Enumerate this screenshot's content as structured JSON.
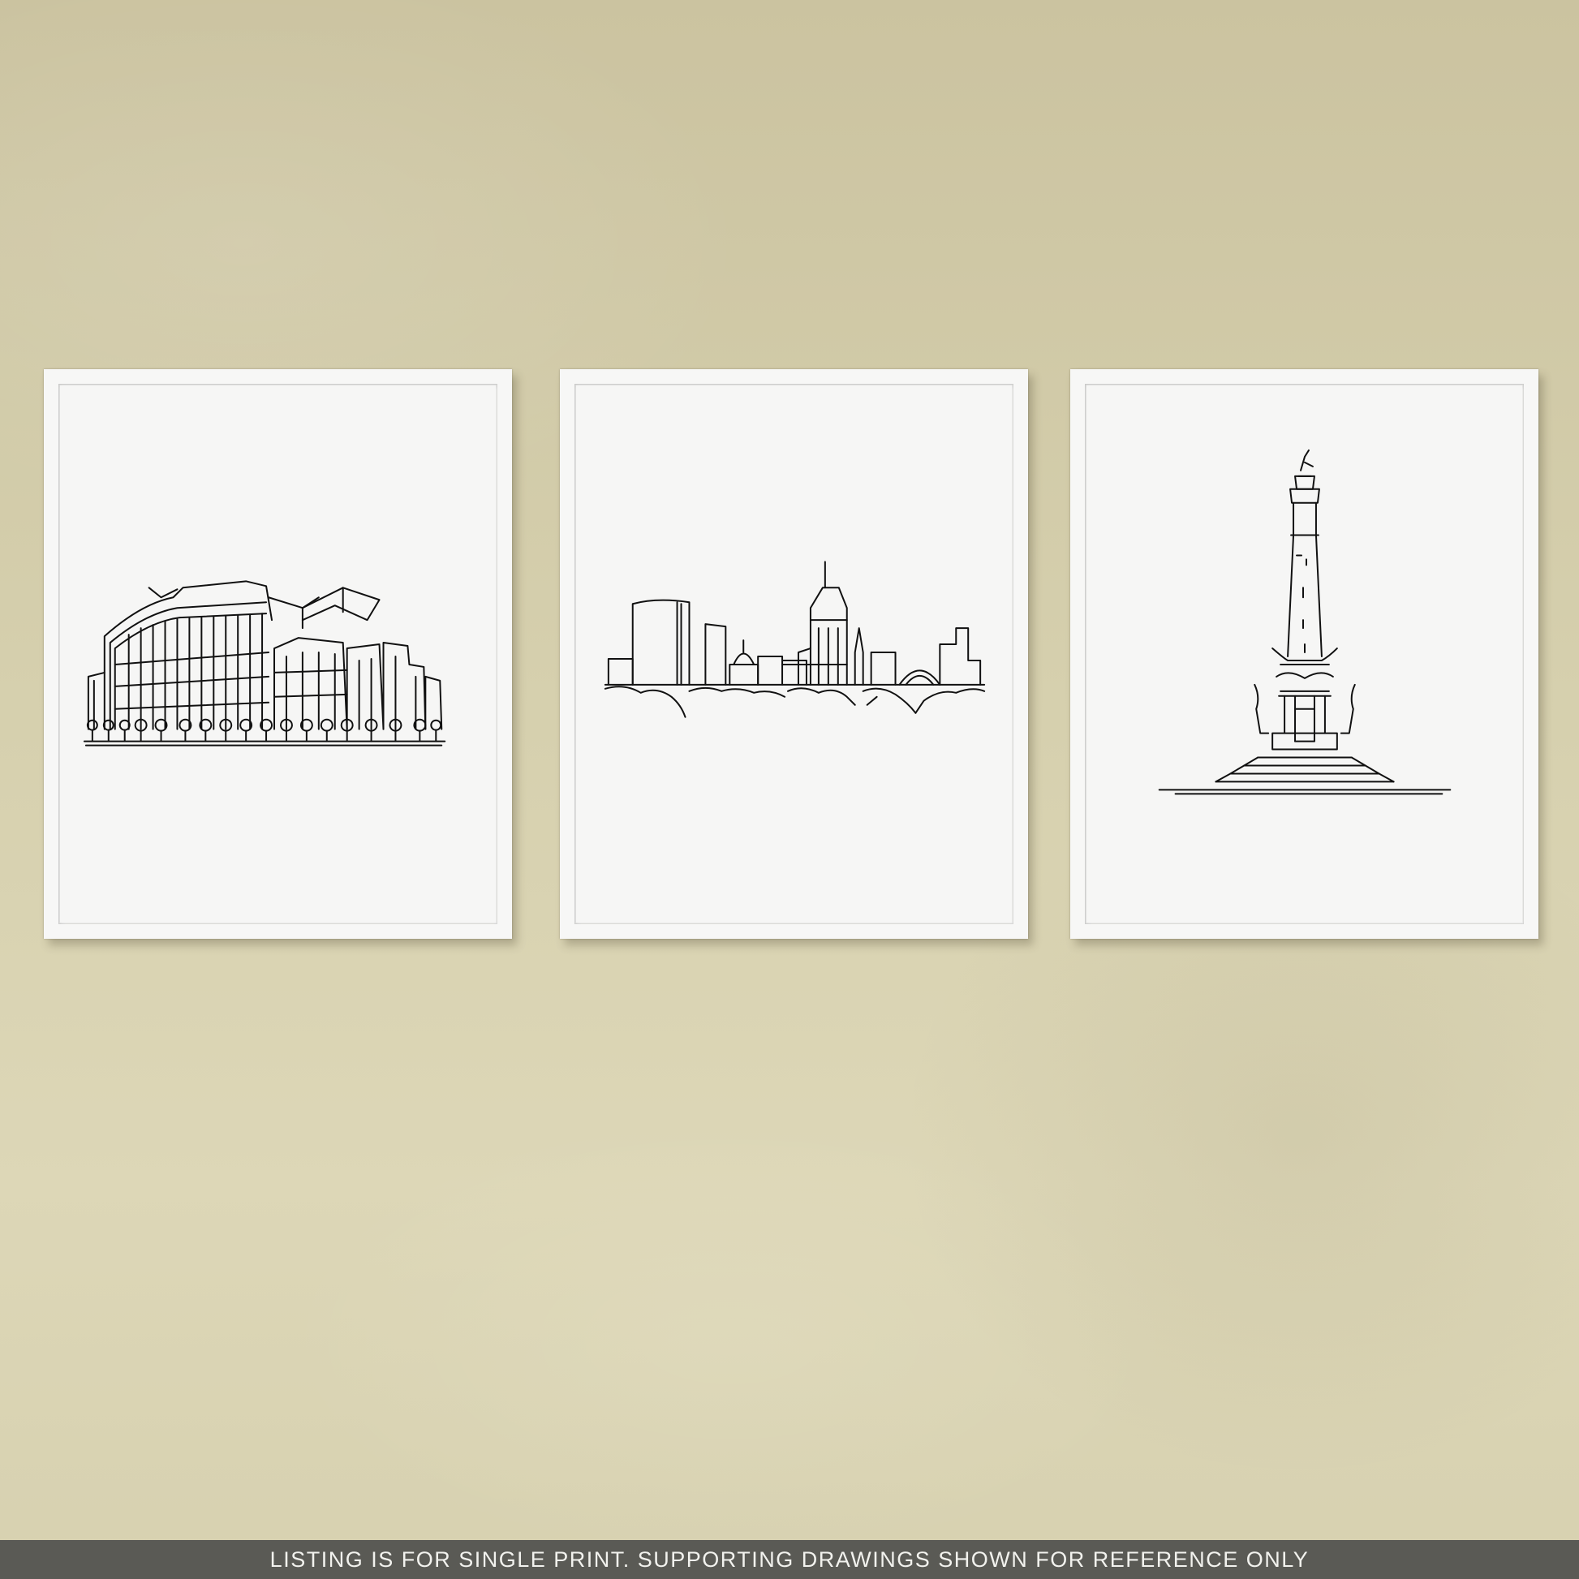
{
  "scene": {
    "wall_color": "#d2cba8",
    "frame_color": "#f7f7f6",
    "line_color": "#111111"
  },
  "artworks": [
    {
      "subject": "stadium line drawing"
    },
    {
      "subject": "city skyline line drawing"
    },
    {
      "subject": "monument line drawing"
    }
  ],
  "banner": {
    "text": "LISTING IS FOR SINGLE PRINT. SUPPORTING DRAWINGS SHOWN FOR REFERENCE ONLY",
    "background": "#5a5a55"
  }
}
